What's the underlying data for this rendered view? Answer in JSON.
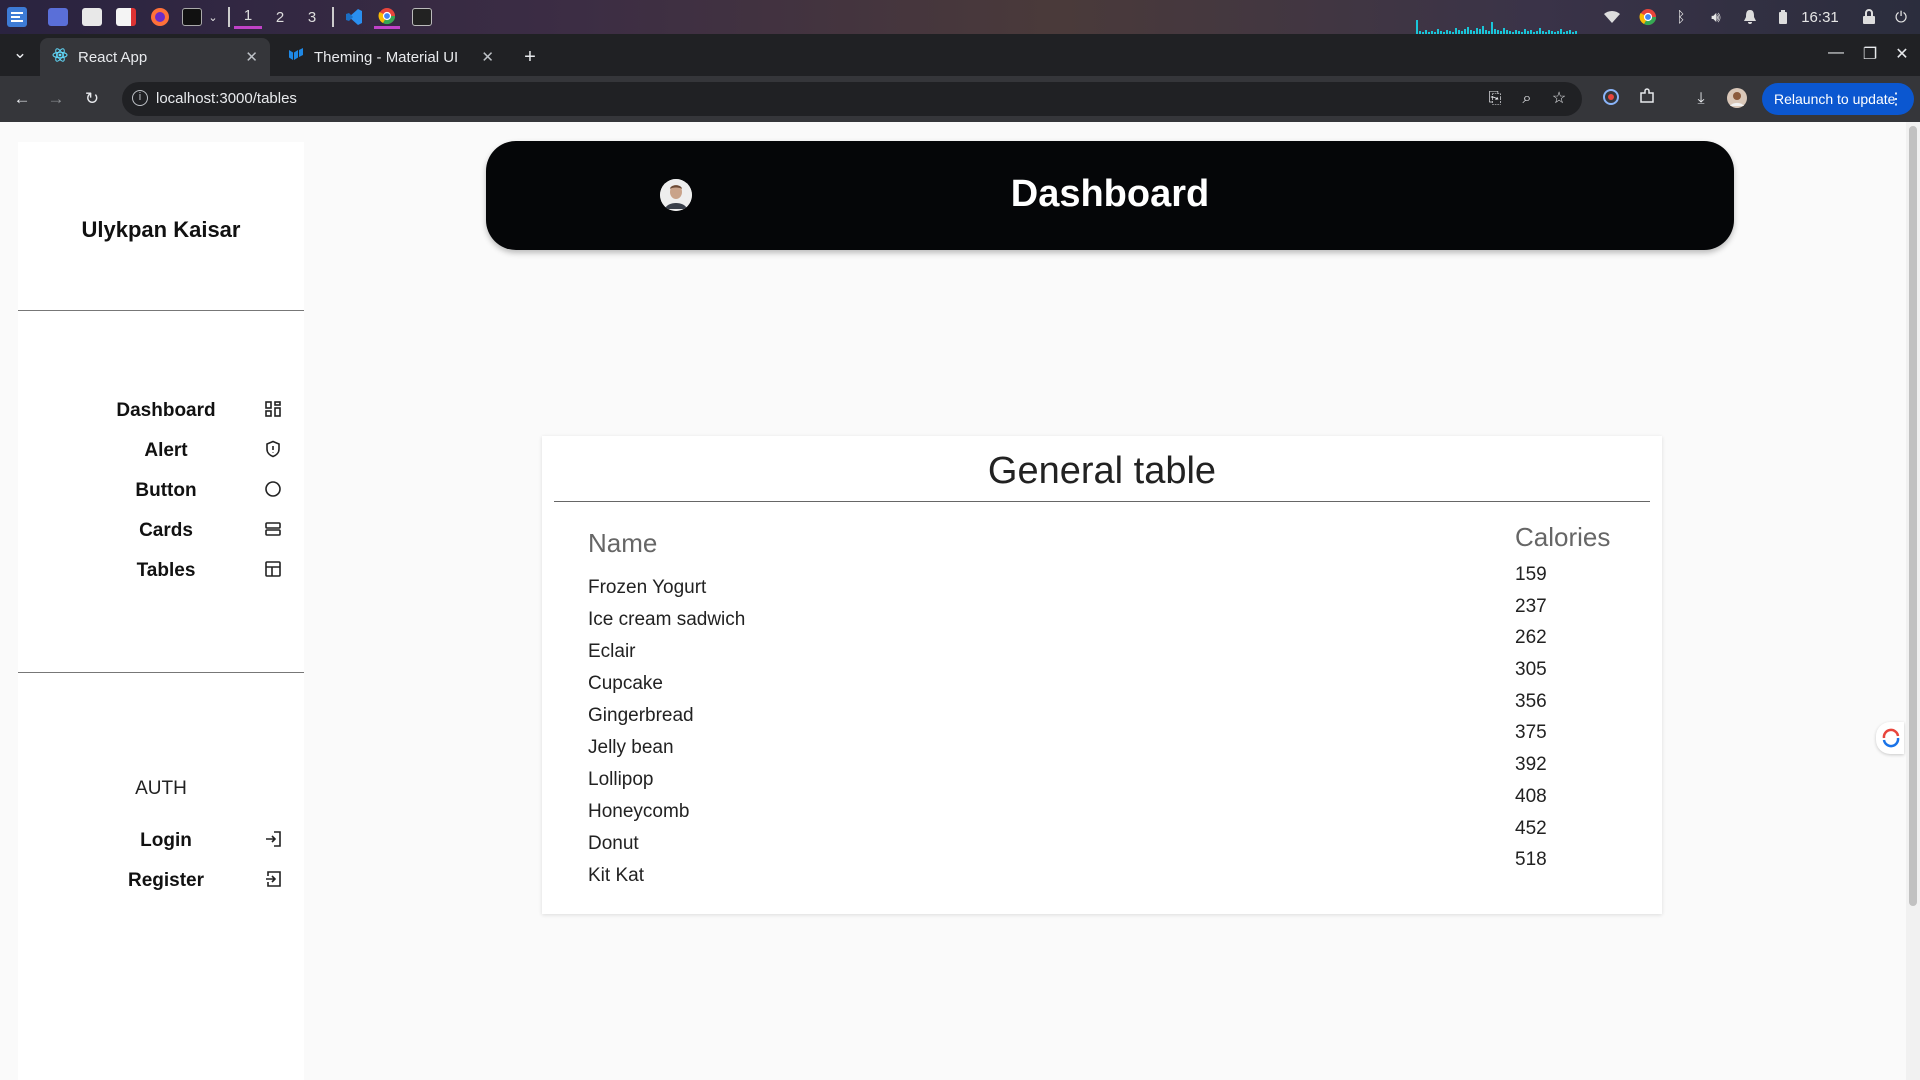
{
  "os": {
    "workspaces": [
      "1",
      "2",
      "3"
    ],
    "clock": "16:31"
  },
  "browser": {
    "tabs": [
      {
        "title": "React App"
      },
      {
        "title": "Theming - Material UI"
      }
    ],
    "new_tab": "+",
    "url": "localhost:3000/tables",
    "relaunch_label": "Relaunch to update"
  },
  "sidebar": {
    "user_name": "Ulykpan Kaisar",
    "nav_items": [
      {
        "label": "Dashboard",
        "icon": "dashboard-icon"
      },
      {
        "label": "Alert",
        "icon": "shield-icon"
      },
      {
        "label": "Button",
        "icon": "circle-icon"
      },
      {
        "label": "Cards",
        "icon": "cards-icon"
      },
      {
        "label": "Tables",
        "icon": "table-icon"
      }
    ],
    "auth_title": "AUTH",
    "auth_items": [
      {
        "label": "Login",
        "icon": "login-icon"
      },
      {
        "label": "Register",
        "icon": "register-icon"
      }
    ]
  },
  "header": {
    "title": "Dashboard"
  },
  "table": {
    "title": "General table",
    "columns": [
      "Name",
      "Calories"
    ],
    "names": [
      "Frozen Yogurt",
      "Ice cream sadwich",
      "Eclair",
      "Cupcake",
      "Gingerbread",
      "Jelly bean",
      "Lollipop",
      "Honeycomb",
      "Donut",
      "Kit Kat"
    ],
    "calories": [
      "159",
      "237",
      "262",
      "305",
      "356",
      "375",
      "392",
      "408",
      "452",
      "518"
    ]
  },
  "colors": {
    "header_bg": "#050608",
    "relaunch_bg": "#0b57d0",
    "page_bg": "#fafafa"
  }
}
